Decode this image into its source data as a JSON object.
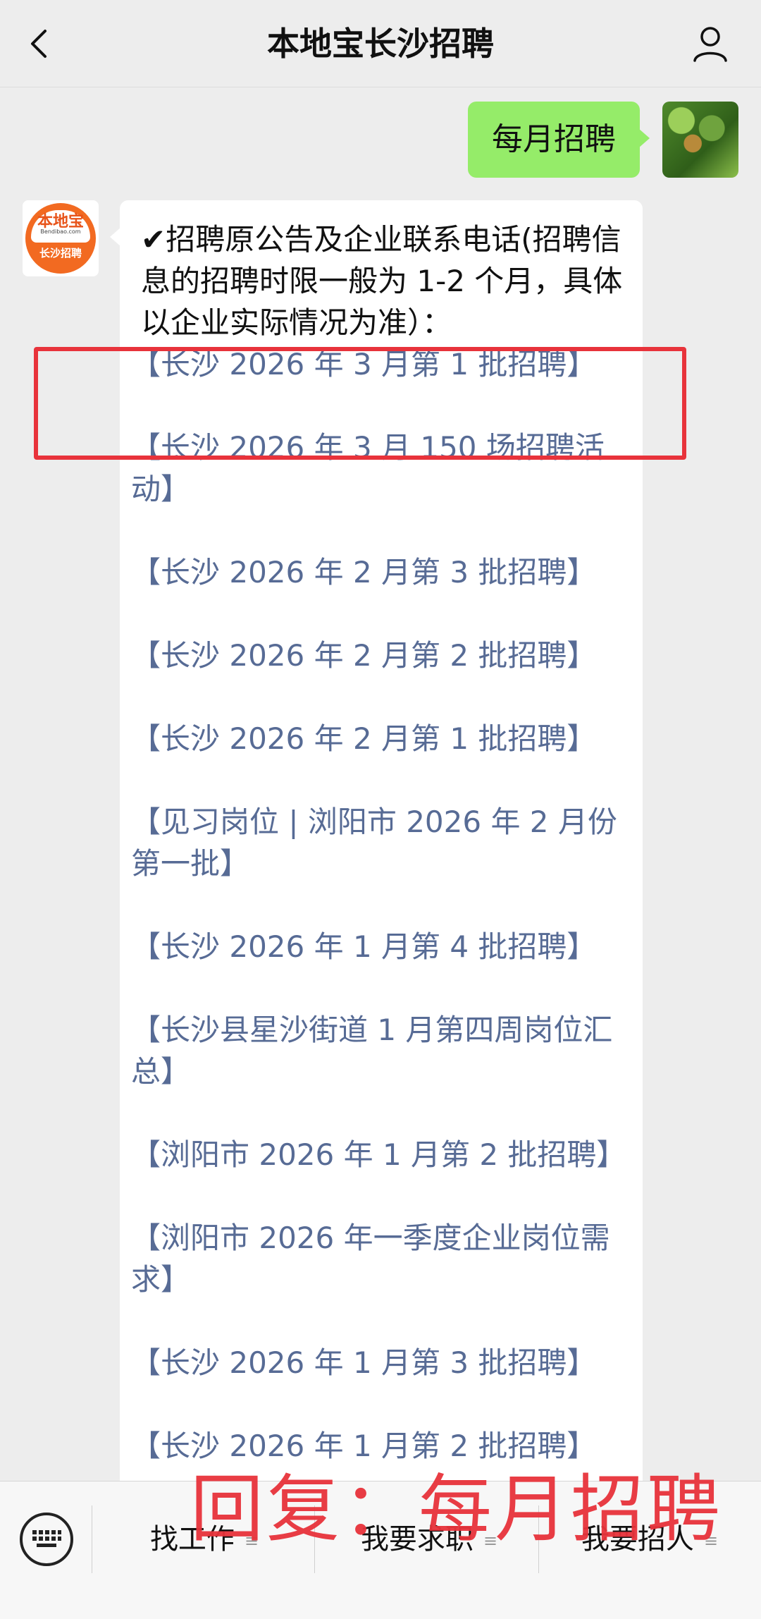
{
  "header": {
    "title": "本地宝长沙招聘",
    "back_icon": "back-chevron-icon",
    "profile_icon": "person-icon"
  },
  "messages": {
    "sent": {
      "text": "每月招聘"
    },
    "bot_avatar": {
      "top": "本地宝",
      "sub": "Bendibao.com",
      "bottom": "长沙招聘"
    },
    "received": {
      "intro": "✔招聘原公告及企业联系电话(招聘信息的招聘时限一般为 1-2 个月，具体以企业实际情况为准）：",
      "links": [
        "【长沙 2026 年 3 月第 1 批招聘】",
        "【长沙 2026 年 3 月 150 场招聘活动】",
        "【长沙 2026 年 2 月第 3 批招聘】",
        "【长沙 2026 年 2 月第 2 批招聘】",
        "【长沙 2026 年 2 月第 1 批招聘】",
        "【见习岗位 | 浏阳市 2026 年 2 月份第一批】",
        "【长沙 2026 年 1 月第 4 批招聘】",
        "【长沙县星沙街道 1 月第四周岗位汇总】",
        "【浏阳市 2026 年 1 月第 2 批招聘】",
        "【浏阳市 2026 年一季度企业岗位需求】",
        "【长沙 2026 年 1 月第 3 批招聘】",
        "【长沙 2026 年 1 月第 2 批招聘】"
      ]
    }
  },
  "bottom_menu": {
    "keyboard_icon": "keyboard-icon",
    "items": [
      "找工作",
      "我要求职",
      "我要招人"
    ],
    "menu_icon": "≡"
  },
  "overlay": {
    "text": "回复：每月招聘"
  },
  "colors": {
    "sent_bubble": "#95ec69",
    "link": "#576b95",
    "highlight": "#e8333b"
  }
}
